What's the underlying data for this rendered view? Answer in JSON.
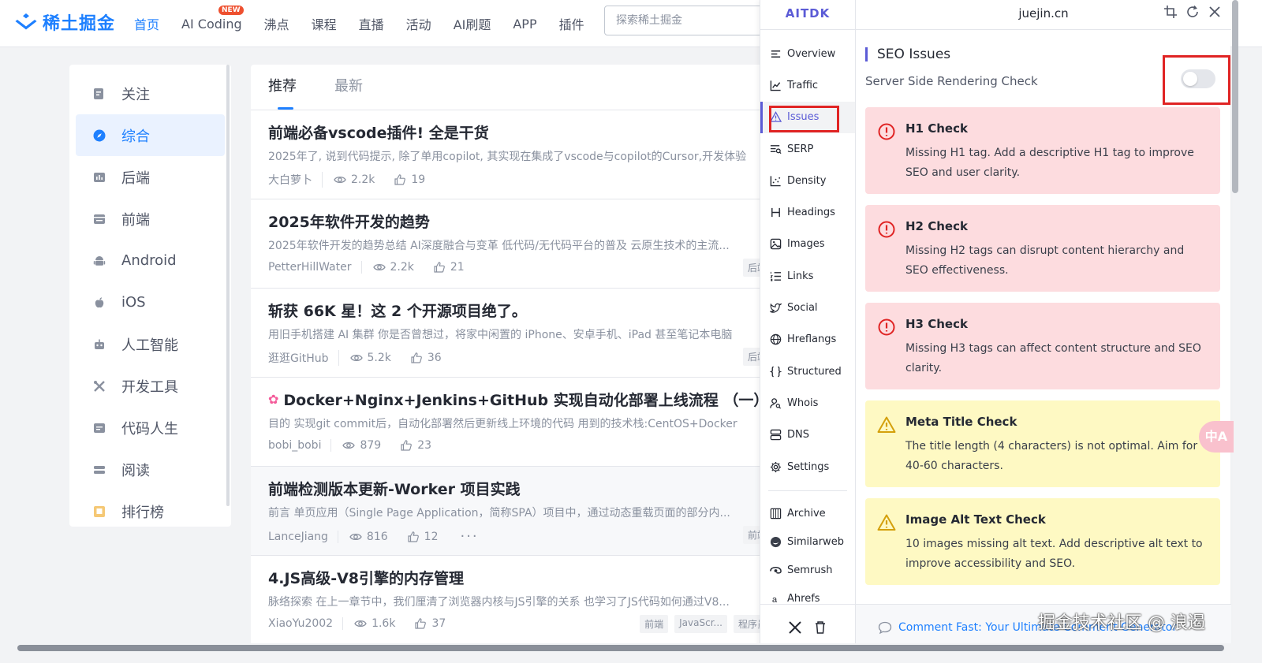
{
  "header": {
    "logo_text": "稀土掘金",
    "nav": [
      {
        "label": "首页",
        "active": true
      },
      {
        "label": "AI Coding",
        "badge": "NEW"
      },
      {
        "label": "沸点"
      },
      {
        "label": "课程"
      },
      {
        "label": "直播"
      },
      {
        "label": "活动"
      },
      {
        "label": "AI刷题"
      },
      {
        "label": "APP"
      },
      {
        "label": "插件"
      }
    ],
    "search_placeholder": "探索稀土掘金"
  },
  "sidebar": {
    "items": [
      {
        "label": "关注",
        "icon": "follow-icon"
      },
      {
        "label": "综合",
        "icon": "compass-icon",
        "active": true
      },
      {
        "label": "后端",
        "icon": "backend-icon"
      },
      {
        "label": "前端",
        "icon": "frontend-icon"
      },
      {
        "label": "Android",
        "icon": "android-icon"
      },
      {
        "label": "iOS",
        "icon": "apple-icon"
      },
      {
        "label": "人工智能",
        "icon": "robot-icon"
      },
      {
        "label": "开发工具",
        "icon": "tools-icon"
      },
      {
        "label": "代码人生",
        "icon": "code-life-icon"
      },
      {
        "label": "阅读",
        "icon": "book-icon"
      },
      {
        "label": "排行榜",
        "icon": "ranking-icon"
      }
    ]
  },
  "feed": {
    "tabs": [
      {
        "label": "推荐",
        "active": true
      },
      {
        "label": "最新"
      }
    ],
    "articles": [
      {
        "title": "前端必备vscode插件! 全是干货",
        "desc": "2025年了, 说到代码提示, 除了单用copilot, 其实现在集成了vscode与copilot的Cursor,开发体验",
        "author": "大白萝卜",
        "views": "2.2k",
        "likes": "19",
        "tags": []
      },
      {
        "title": "2025年软件开发的趋势",
        "desc": "2025年软件开发的趋势总结 AI深度融合与变革 低代码/无代码平台的普及 云原生技术的主流...",
        "author": "PetterHillWater",
        "views": "2.2k",
        "likes": "21",
        "tags": [
          "后端"
        ]
      },
      {
        "title": "斩获 66K 星！这 2 个开源项目绝了。",
        "desc": "用旧手机搭建 AI 集群 你是否曾想过，将家中闲置的 iPhone、安卓手机、iPad 甚至笔记本电脑",
        "author": "逛逛GitHub",
        "views": "5.2k",
        "likes": "36",
        "tags": [
          "后端"
        ]
      },
      {
        "title": "Docker+Nginx+Jenkins+GitHub 实现自动化部署上线流程 （一）",
        "desc": "目的 实现git commit后，自动化部署然后更新线上环境的代码 用到的技术栈:CentOS+Docker",
        "author": "bobi_bobi",
        "views": "879",
        "likes": "23",
        "tags": [],
        "flower": "✿"
      },
      {
        "title": "前端检测版本更新-Worker 项目实践",
        "desc": "前言 单页应用（Single Page Application，简称SPA）项目中，通过动态重载页面的部分内...",
        "author": "LanceJiang",
        "views": "816",
        "likes": "12",
        "tags": [
          "前端"
        ],
        "more": "···"
      },
      {
        "title": "4.JS高级-V8引擎的内存管理",
        "desc": "脉络探索 在上一章节中，我们厘清了浏览器内核与JS引擎的关系 也学习了JS代码如何通过V8...",
        "author": "XiaoYu2002",
        "views": "1.6k",
        "likes": "37",
        "tags": [
          "前端",
          "JavaScr...",
          "程序员"
        ]
      }
    ]
  },
  "panel": {
    "brand": "AITDK",
    "domain": "juejin.cn",
    "nav": [
      {
        "label": "Overview",
        "icon": "overview-icon"
      },
      {
        "label": "Traffic",
        "icon": "traffic-icon"
      },
      {
        "label": "Issues",
        "icon": "warning-icon",
        "active": true
      },
      {
        "label": "SERP",
        "icon": "serp-icon"
      },
      {
        "label": "Density",
        "icon": "density-icon"
      },
      {
        "label": "Headings",
        "icon": "heading-icon"
      },
      {
        "label": "Images",
        "icon": "image-icon"
      },
      {
        "label": "Links",
        "icon": "links-icon"
      },
      {
        "label": "Social",
        "icon": "twitter-bird-icon"
      },
      {
        "label": "Hreflangs",
        "icon": "globe-icon"
      },
      {
        "label": "Structured",
        "icon": "braces-icon"
      },
      {
        "label": "Whois",
        "icon": "user-search-icon"
      },
      {
        "label": "DNS",
        "icon": "server-icon"
      },
      {
        "label": "Settings",
        "icon": "gear-icon"
      }
    ],
    "nav_external": [
      {
        "label": "Archive",
        "icon": "archive-icon"
      },
      {
        "label": "Similarweb",
        "icon": "similarweb-icon"
      },
      {
        "label": "Semrush",
        "icon": "semrush-icon"
      },
      {
        "label": "Ahrefs",
        "icon": "ahrefs-icon"
      }
    ],
    "section_title": "SEO Issues",
    "ssr_label": "Server Side Rendering Check",
    "ssr_enabled": false,
    "issues": [
      {
        "title": "H1 Check",
        "desc": "Missing H1 tag. Add a descriptive H1 tag to improve SEO and user clarity.",
        "level": "error"
      },
      {
        "title": "H2 Check",
        "desc": "Missing H2 tags can disrupt content hierarchy and SEO effectiveness.",
        "level": "error"
      },
      {
        "title": "H3 Check",
        "desc": "Missing H3 tags can affect content structure and SEO clarity.",
        "level": "error"
      },
      {
        "title": "Meta Title Check",
        "desc": "The title length (4 characters) is not optimal. Aim for 40-60 characters.",
        "level": "warning"
      },
      {
        "title": "Image Alt Text Check",
        "desc": "10 images missing alt text. Add descriptive alt text to improve accessibility and SEO.",
        "level": "warning"
      }
    ],
    "footer_text": "Comment Fast: Your Ultimate Comment Generator",
    "colors": {
      "accent": "#5b5bd6",
      "error_bg": "#fddcdf",
      "warn_bg": "#fef9c3",
      "error": "#e02424",
      "warn": "#d4a00b"
    }
  },
  "overlay": {
    "watermark": "掘金技术社区 @ 浪遏",
    "translate_label": "中A"
  }
}
